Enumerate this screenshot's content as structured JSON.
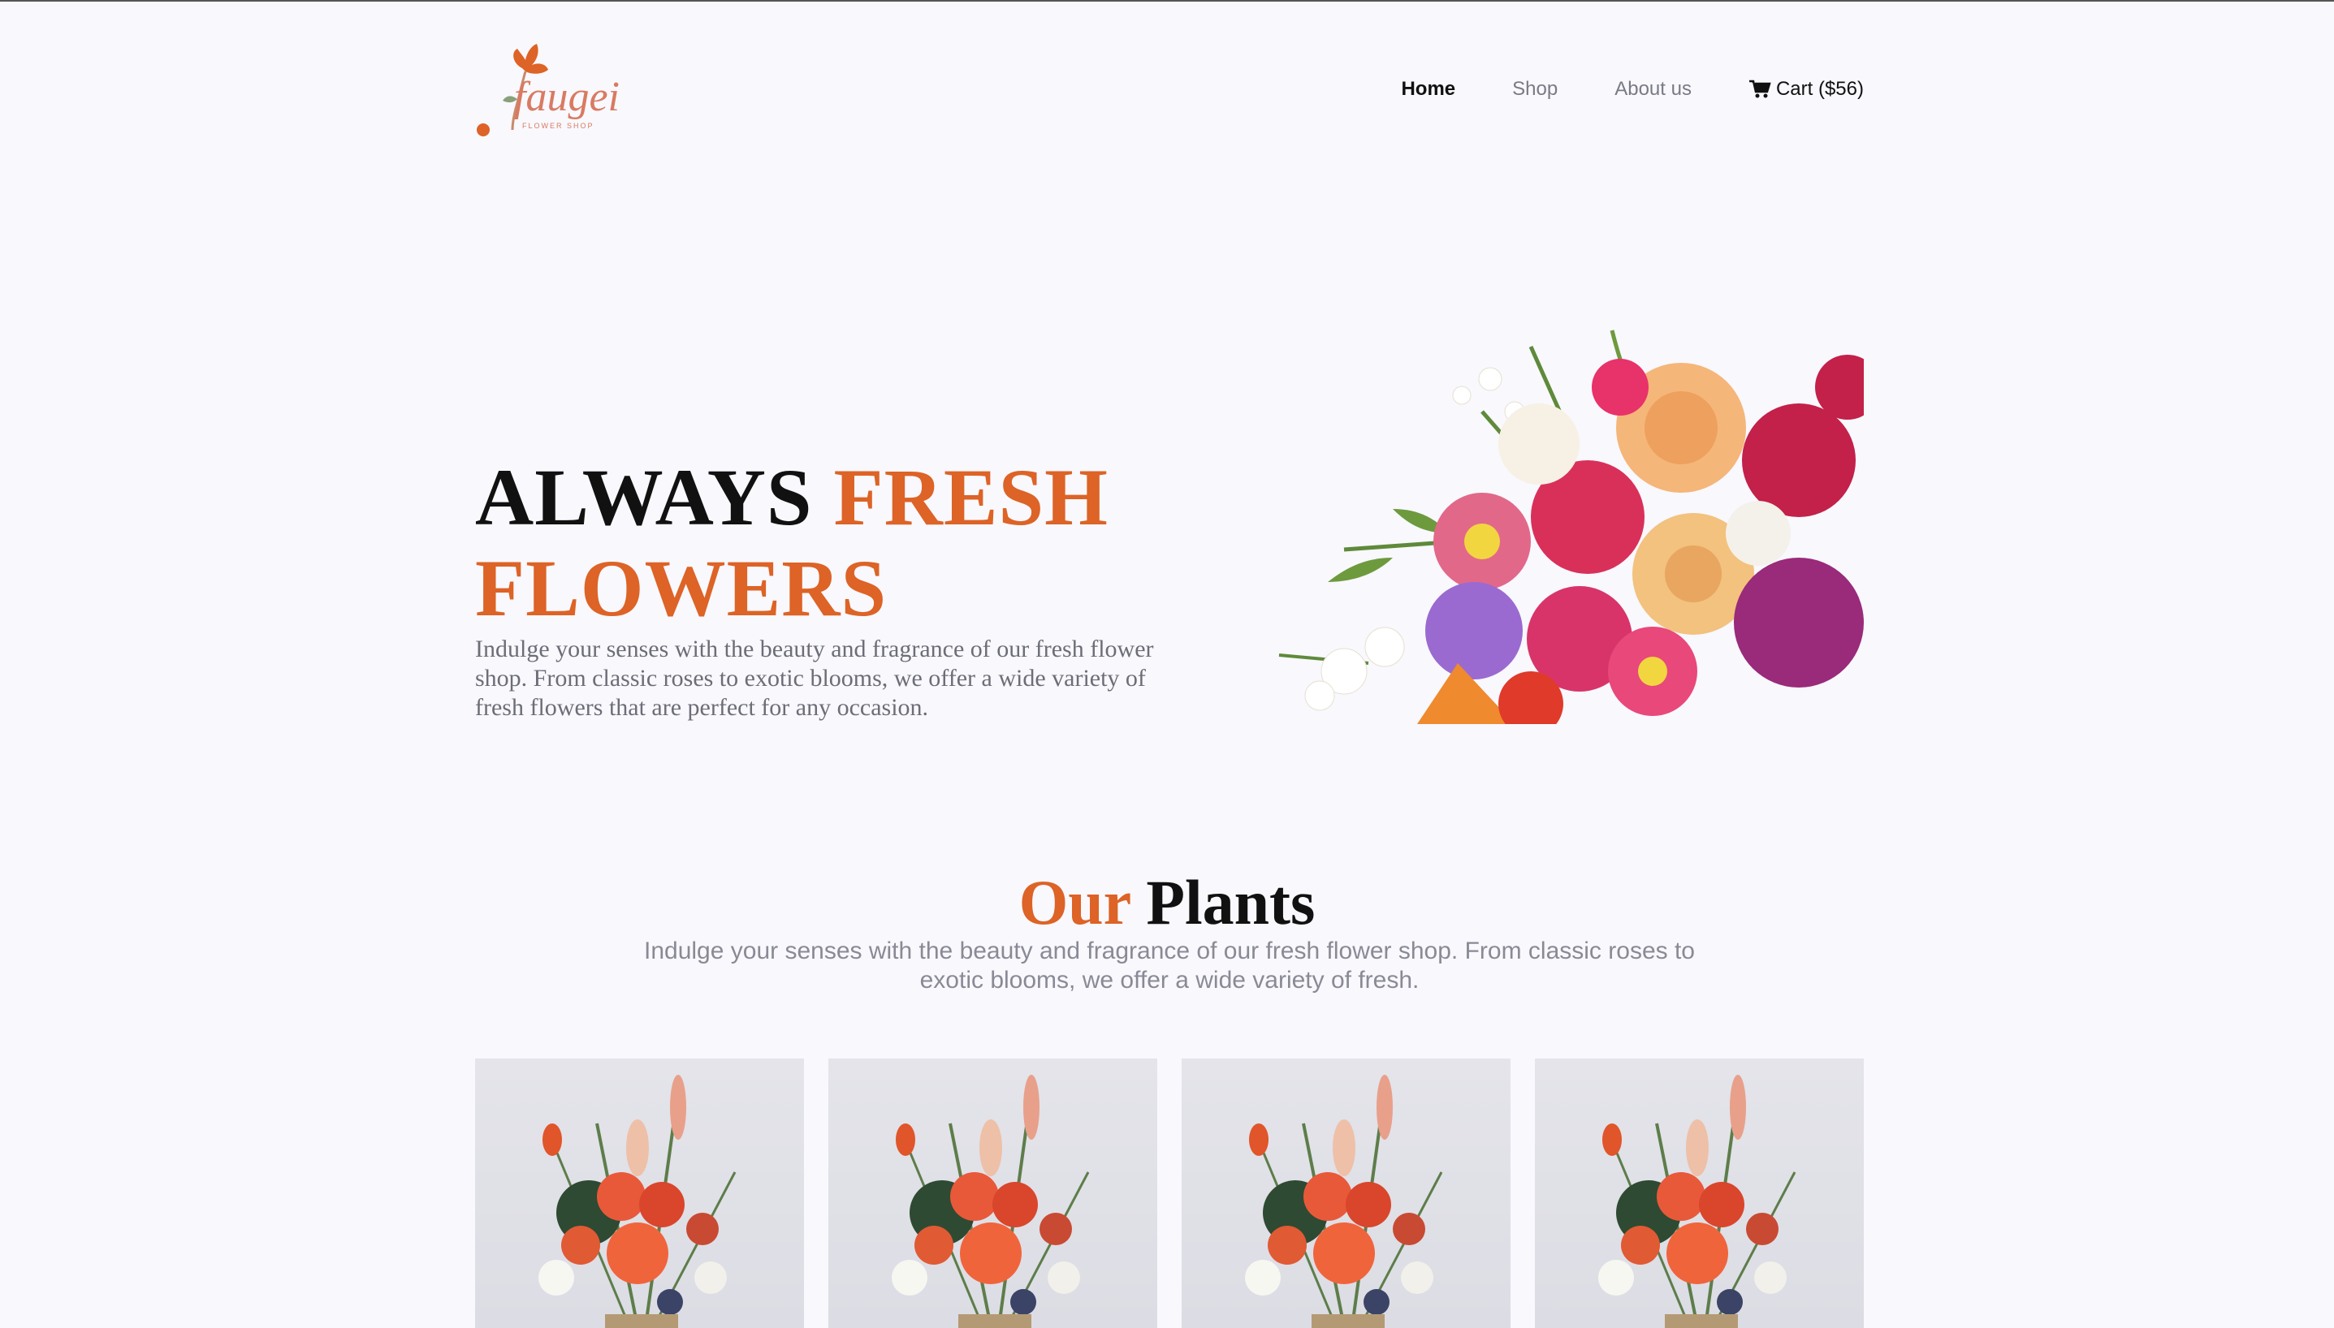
{
  "brand": {
    "name": "faugei",
    "tagline": "FLOWER SHOP"
  },
  "nav": {
    "items": [
      {
        "label": "Home",
        "active": true
      },
      {
        "label": "Shop",
        "active": false
      },
      {
        "label": "About us",
        "active": false
      }
    ],
    "cart_label": "Cart ($56)",
    "cart_icon": "shopping-cart-icon"
  },
  "hero": {
    "title_part1": "ALWAYS ",
    "title_part2": "FRESH",
    "title_part3": "FLOWERS",
    "description": "Indulge your senses with the beauty and fragrance of our fresh flower shop. From classic roses to exotic blooms, we offer a wide variety of fresh flowers that are perfect for any occasion."
  },
  "plants_section": {
    "title_accent": "Our",
    "title_rest": " Plants",
    "description": "Indulge your senses with the beauty and fragrance of our fresh flower shop. From classic roses to exotic blooms, we offer a wide variety of fresh."
  },
  "colors": {
    "accent": "#dd6326",
    "background": "#f8f8fd",
    "text_dark": "#111111",
    "text_muted": "#6d6d78"
  }
}
